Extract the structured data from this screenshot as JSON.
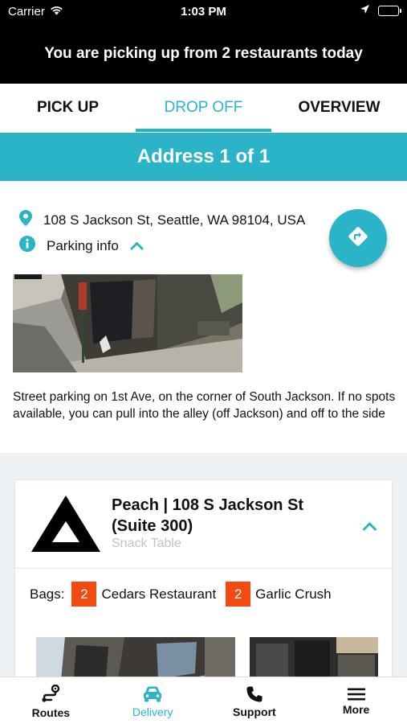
{
  "status_bar": {
    "carrier": "Carrier",
    "time": "1:03 PM",
    "icons": [
      "wifi-icon",
      "location-arrow-icon",
      "battery-icon"
    ]
  },
  "header": {
    "title": "You are picking up from 2 restaurants today"
  },
  "tabs": [
    {
      "label": "PICK UP",
      "active": false
    },
    {
      "label": "DROP OFF",
      "active": true
    },
    {
      "label": "OVERVIEW",
      "active": false
    }
  ],
  "address_banner": {
    "label": "Address 1 of 1"
  },
  "address": {
    "street": "108 S Jackson St, Seattle, WA 98104, USA",
    "parking_label": "Parking info",
    "parking_expanded": true,
    "parking_description": "Street parking on 1st Ave, on the corner of South Jackson. If no spots available, you can pull into the alley (off Jackson) and off to the side",
    "directions_icon": "directions-icon"
  },
  "location_card": {
    "title": "Peach | 108 S Jackson St (Suite 300)",
    "subtitle": "Snack Table",
    "expanded": true,
    "bags_label": "Bags:",
    "bags": [
      {
        "count": "2",
        "restaurant": "Cedars Restaurant"
      },
      {
        "count": "2",
        "restaurant": "Garlic Crush"
      }
    ]
  },
  "bottom_nav": [
    {
      "label": "Routes",
      "icon": "route-icon",
      "active": false
    },
    {
      "label": "Delivery",
      "icon": "car-icon",
      "active": true
    },
    {
      "label": "Support",
      "icon": "phone-icon",
      "active": false
    },
    {
      "label": "More",
      "icon": "menu-icon",
      "active": false
    }
  ],
  "colors": {
    "accent": "#2bb3c8",
    "bag_badge": "#f24a11",
    "header_bg": "#000000",
    "content_bg": "#eef1f3"
  }
}
